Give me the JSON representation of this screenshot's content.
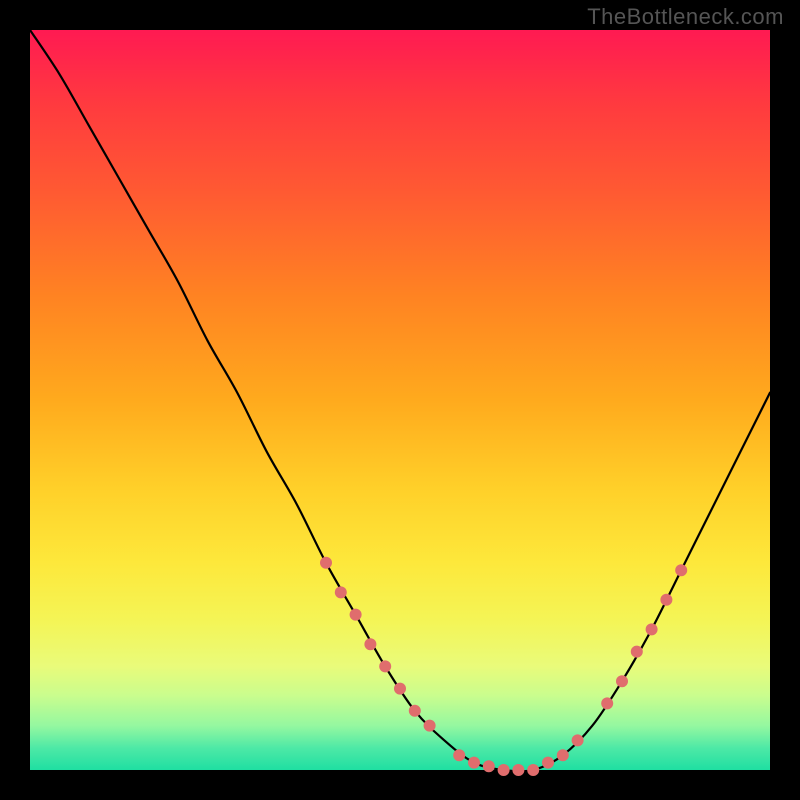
{
  "watermark": "TheBottleneck.com",
  "colors": {
    "background": "#000000",
    "gradient_top": "#ff1a52",
    "gradient_mid": "#ffe83b",
    "gradient_bottom": "#1fdfa2",
    "curve": "#000000",
    "marker": "#e06d6d"
  },
  "chart_data": {
    "type": "line",
    "title": "",
    "xlabel": "",
    "ylabel": "",
    "xlim": [
      0,
      100
    ],
    "ylim": [
      0,
      100
    ],
    "x": [
      0,
      4,
      8,
      12,
      16,
      20,
      24,
      28,
      32,
      36,
      40,
      44,
      48,
      52,
      56,
      60,
      64,
      68,
      72,
      76,
      80,
      84,
      88,
      92,
      96,
      100
    ],
    "y": [
      100,
      94,
      87,
      80,
      73,
      66,
      58,
      51,
      43,
      36,
      28,
      21,
      14,
      8,
      4,
      1,
      0,
      0,
      2,
      6,
      12,
      19,
      27,
      35,
      43,
      51
    ],
    "annotations": [
      {
        "x": 40,
        "y": 28
      },
      {
        "x": 42,
        "y": 24
      },
      {
        "x": 44,
        "y": 21
      },
      {
        "x": 46,
        "y": 17
      },
      {
        "x": 48,
        "y": 14
      },
      {
        "x": 50,
        "y": 11
      },
      {
        "x": 52,
        "y": 8
      },
      {
        "x": 54,
        "y": 6
      },
      {
        "x": 58,
        "y": 2
      },
      {
        "x": 60,
        "y": 1
      },
      {
        "x": 62,
        "y": 0.5
      },
      {
        "x": 64,
        "y": 0
      },
      {
        "x": 66,
        "y": 0
      },
      {
        "x": 68,
        "y": 0
      },
      {
        "x": 70,
        "y": 1
      },
      {
        "x": 72,
        "y": 2
      },
      {
        "x": 74,
        "y": 4
      },
      {
        "x": 78,
        "y": 9
      },
      {
        "x": 80,
        "y": 12
      },
      {
        "x": 82,
        "y": 16
      },
      {
        "x": 84,
        "y": 19
      },
      {
        "x": 86,
        "y": 23
      },
      {
        "x": 88,
        "y": 27
      }
    ]
  }
}
